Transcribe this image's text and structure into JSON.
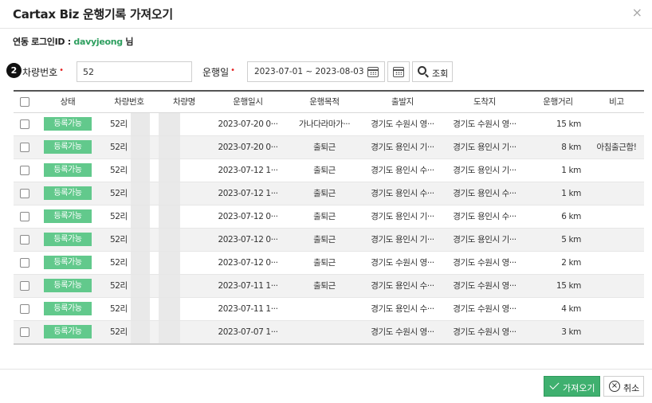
{
  "dialog": {
    "title": "Cartax Biz 운행기록 가져오기",
    "close_glyph": "×"
  },
  "login": {
    "label": "연동 로그인ID : ",
    "user_id": "davyjeong",
    "suffix": " 님"
  },
  "filter": {
    "step_number": "2",
    "car_label": "차량번호",
    "required_mark": "•",
    "car_value": "52",
    "date_label": "운행일",
    "date_range": "2023-07-01  ~  2023-08-03",
    "search_label": "조회"
  },
  "table": {
    "columns": [
      "상태",
      "차량번호",
      "차량명",
      "운행일시",
      "운행목적",
      "출발지",
      "도착지",
      "운행거리",
      "비고"
    ],
    "rows": [
      {
        "status": "등록가능",
        "car_no": "52리",
        "car_name": "",
        "datetime": "2023-07-20 0···",
        "purpose": "가나다라마가···",
        "departure": "경기도 수원시 영···",
        "arrival": "경기도 수원시 영···",
        "distance": "15 km",
        "note": ""
      },
      {
        "status": "등록가능",
        "car_no": "52리",
        "car_name": "",
        "datetime": "2023-07-20 0···",
        "purpose": "출퇴근",
        "departure": "경기도 용인시 기···",
        "arrival": "경기도 용인시 기···",
        "distance": "8 km",
        "note": "아침출근함!"
      },
      {
        "status": "등록가능",
        "car_no": "52리",
        "car_name": "",
        "datetime": "2023-07-12 1···",
        "purpose": "출퇴근",
        "departure": "경기도 용인시 수···",
        "arrival": "경기도 용인시 기···",
        "distance": "1 km",
        "note": ""
      },
      {
        "status": "등록가능",
        "car_no": "52리",
        "car_name": "",
        "datetime": "2023-07-12 1···",
        "purpose": "출퇴근",
        "departure": "경기도 용인시 수···",
        "arrival": "경기도 용인시 수···",
        "distance": "1 km",
        "note": ""
      },
      {
        "status": "등록가능",
        "car_no": "52리",
        "car_name": "",
        "datetime": "2023-07-12 0···",
        "purpose": "출퇴근",
        "departure": "경기도 용인시 기···",
        "arrival": "경기도 용인시 수···",
        "distance": "6 km",
        "note": ""
      },
      {
        "status": "등록가능",
        "car_no": "52리",
        "car_name": "",
        "datetime": "2023-07-12 0···",
        "purpose": "출퇴근",
        "departure": "경기도 용인시 기···",
        "arrival": "경기도 용인시 기···",
        "distance": "5 km",
        "note": ""
      },
      {
        "status": "등록가능",
        "car_no": "52리",
        "car_name": "",
        "datetime": "2023-07-12 0···",
        "purpose": "출퇴근",
        "departure": "경기도 수원시 영···",
        "arrival": "경기도 수원시 영···",
        "distance": "2 km",
        "note": ""
      },
      {
        "status": "등록가능",
        "car_no": "52리",
        "car_name": "",
        "datetime": "2023-07-11 1···",
        "purpose": "출퇴근",
        "departure": "경기도 용인시 수···",
        "arrival": "경기도 수원시 영···",
        "distance": "15 km",
        "note": ""
      },
      {
        "status": "등록가능",
        "car_no": "52리",
        "car_name": "",
        "datetime": "2023-07-11 1···",
        "purpose": "",
        "departure": "경기도 용인시 수···",
        "arrival": "경기도 수원시 영···",
        "distance": "4 km",
        "note": ""
      },
      {
        "status": "등록가능",
        "car_no": "52리",
        "car_name": "",
        "datetime": "2023-07-07 1···",
        "purpose": "",
        "departure": "경기도 수원시 영···",
        "arrival": "경기도 수원시 영···",
        "distance": "3 km",
        "note": ""
      }
    ]
  },
  "footer": {
    "import_label": "가져오기",
    "cancel_label": "취소"
  },
  "colors": {
    "accent_green": "#3fb06f",
    "status_badge": "#62c98c",
    "required_red": "#e52323",
    "user_id_green": "#2e9f5f"
  }
}
